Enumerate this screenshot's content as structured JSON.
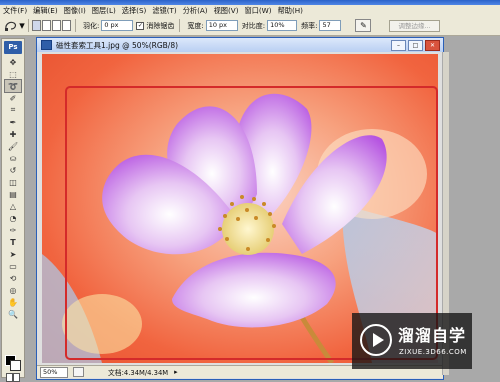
{
  "menubar": {
    "items": [
      "文件(F)",
      "编辑(E)",
      "图像(I)",
      "图层(L)",
      "选择(S)",
      "滤镜(T)",
      "分析(A)",
      "视图(V)",
      "窗口(W)",
      "帮助(H)"
    ]
  },
  "options": {
    "feather_label": "羽化:",
    "feather_value": "0 px",
    "antialias_label": "消除锯齿",
    "width_label": "宽度:",
    "width_value": "10 px",
    "contrast_label": "对比度:",
    "contrast_value": "10%",
    "frequency_label": "频率:",
    "frequency_value": "57",
    "refine_edge_label": "调整边缘..."
  },
  "toolbox": {
    "logo": "Ps"
  },
  "document": {
    "title": "磁性套索工具1.jpg @ 50%(RGB/8)",
    "zoom": "50%",
    "doc_info": "文档:4.34M/4.34M"
  },
  "watermark": {
    "name": "溜溜自学",
    "url": "ZIXUE.3D66.COM"
  },
  "colors": {
    "selection": "#d42a2a",
    "petal": "#c77ee6",
    "background": "#f47a5a"
  }
}
